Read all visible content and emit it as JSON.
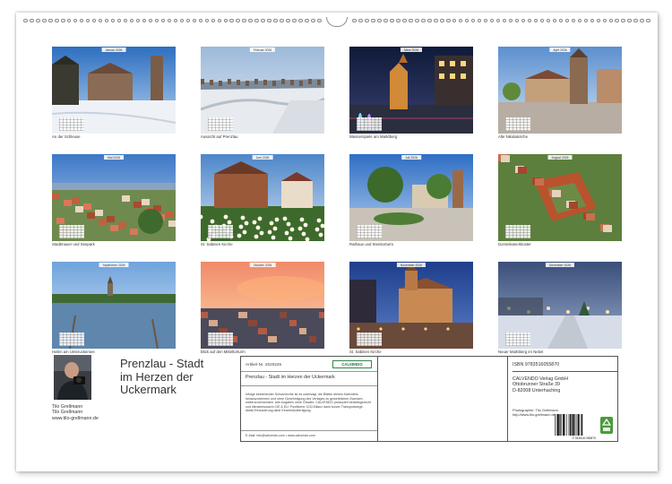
{
  "months": [
    {
      "tag": "Januar 2026",
      "caption": "An der Schleuse",
      "scene": "snow-castle"
    },
    {
      "tag": "Februar 2026",
      "caption": "Aussicht auf Prenzlau",
      "scene": "winter-panorama"
    },
    {
      "tag": "März 2026",
      "caption": "Wasserspiele am Marktberg",
      "scene": "night-fountain"
    },
    {
      "tag": "April 2026",
      "caption": "Alte Nikolaikirche",
      "scene": "tower-plaza"
    },
    {
      "tag": "Mai 2026",
      "caption": "Stadtmauer und Seepark",
      "scene": "aerial-town"
    },
    {
      "tag": "Juni 2026",
      "caption": "St. Sabinen Kirche",
      "scene": "church-flowers"
    },
    {
      "tag": "Juli 2026",
      "caption": "Rathaus und Steintorturm",
      "scene": "green-plaza"
    },
    {
      "tag": "August 2026",
      "caption": "Dominikanerkloster",
      "scene": "aerial-monastery"
    },
    {
      "tag": "September 2026",
      "caption": "Hafen am Unteruckersee",
      "scene": "lake-harbor"
    },
    {
      "tag": "Oktober 2026",
      "caption": "Blick auf den Mitteltorturm",
      "scene": "sunset-town"
    },
    {
      "tag": "November 2026",
      "caption": "St. Sabinen Kirche",
      "scene": "blue-hour-church"
    },
    {
      "tag": "Dezember 2026",
      "caption": "Neuer Marktberg im Nebel",
      "scene": "foggy-night"
    }
  ],
  "author": {
    "lines": [
      "Tilo Grellmann",
      "Tilo Grellmann",
      "www.tilo-grellmann.de"
    ]
  },
  "title_lines": [
    "Prenzlau - Stadt",
    "im Herzen der",
    "Uckermark"
  ],
  "info": {
    "art_nr": "Artikel-Nr. 2020226",
    "logo": "CALVENDO",
    "box_title": "Prenzlau - Stadt im Herzen der Uckermark",
    "legal": "Infolge bestehender Schutzrechte ist es untersagt, die Blätter dieses Kalenders herauszutrennen und ohne Genehmigung des Verlages zu gewerblichen Zwecken weiterzuverwenden. Alle Angaben ohne Gewähr. CALVENDO produziert bedarfsgerecht und klimabewusst in DE & EU. Positiverer CO2-Bilanz dank kurzer Transportwege. Abfall-Reduzierung dank Einzelstückfertigung.",
    "email": "E-Mail: info@calvendo.com • www.calvendo.com",
    "isbn": "ISBN 9783516055870",
    "publisher": [
      "CALVENDO Verlag GmbH",
      "Ottobrunner Straße 39",
      "D-82008 Unterhaching"
    ],
    "photographer": [
      "Photographer: Tilo Grellmann",
      "http://www.tilo-grellmann.de"
    ],
    "barcode_digits": "9 783516 055870"
  }
}
